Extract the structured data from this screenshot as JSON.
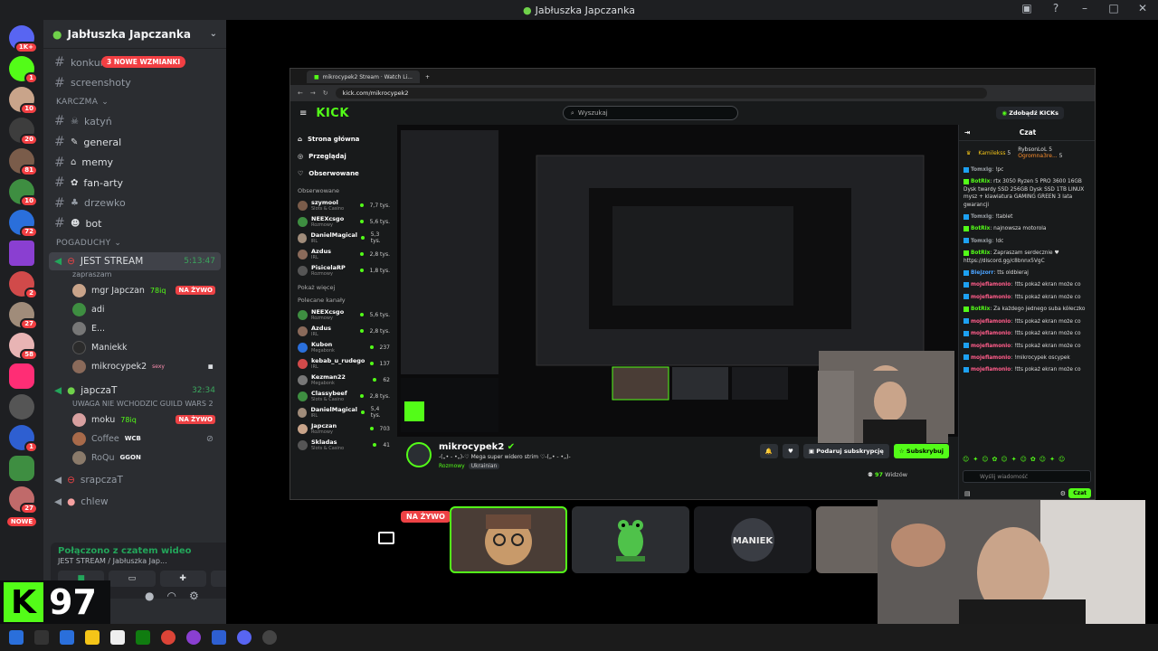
{
  "window": {
    "title": "Jabłuszka Japczanka"
  },
  "rail": {
    "top_badge": "1K+",
    "badges": [
      "1",
      "10",
      "20",
      "81",
      "10",
      "72",
      "2",
      "27",
      "58",
      "1",
      "1",
      "27"
    ],
    "new_label": "NOWE"
  },
  "guild": {
    "name": "Jabłuszka Japczanka",
    "mentions_pill": "3 NOWE WZMIANKI",
    "top_channels": [
      "konkurs-info",
      "screenshoty"
    ],
    "category_karczma": "KARCZMA",
    "channels": [
      "katyń",
      "general",
      "memy",
      "fan-arty",
      "drzewko",
      "bot"
    ],
    "category_pogaduchy": "POGADUCHY",
    "voice1": {
      "name": "JEST STREAM",
      "time": "5:13:47",
      "subtitle": "zapraszam"
    },
    "members1": [
      {
        "name": "mgr Japczan",
        "tag": "78iq",
        "live": "NA ŻYWO"
      },
      {
        "name": "adi"
      },
      {
        "name": "E..."
      },
      {
        "name": "Maniekk"
      },
      {
        "name": "mikrocypek2",
        "tag": "sexy"
      }
    ],
    "voice2": {
      "name": "japczaT",
      "time": "32:34",
      "subtitle": "UWAGA NIE WCHODZIC GUILD WARS 2"
    },
    "members2": [
      {
        "name": "moku",
        "tag": "78iq",
        "live": "NA ŻYWO"
      },
      {
        "name": "Coffee",
        "tag": "WCB"
      },
      {
        "name": "RoQu",
        "tag": "GGON"
      }
    ],
    "more_voice": [
      "srapczaT",
      "chlew"
    ]
  },
  "voice_panel": {
    "status": "Połączono z czatem wideo",
    "location": "JEST STREAM / Jabłuszka Jap..."
  },
  "overlay": {
    "viewers": "97"
  },
  "browser": {
    "tab_title": "mikrocypek2 Stream · Watch Li...",
    "url": "kick.com/mikrocypek2"
  },
  "kick": {
    "brand": "KICK",
    "search_placeholder": "Wyszukaj",
    "get_kicks": "Zdobądź KICKs",
    "nav": [
      "Strona główna",
      "Przeglądaj",
      "Obserwowane"
    ],
    "followed_header": "Obserwowane",
    "followed": [
      {
        "name": "szymool",
        "sub": "Slots & Casino",
        "count": "7,7 tys."
      },
      {
        "name": "NEEXcsgo",
        "sub": "Rozmowy",
        "count": "5,6 tys."
      },
      {
        "name": "DanielMagical",
        "sub": "IRL",
        "count": "5,3 tys."
      },
      {
        "name": "Azdus",
        "sub": "IRL",
        "count": "2,8 tys."
      },
      {
        "name": "PisicelaRP",
        "sub": "Rozmowy",
        "count": "1,8 tys."
      }
    ],
    "show_more": "Pokaż więcej",
    "recommended_header": "Polecane kanały",
    "recommended": [
      {
        "name": "NEEXcsgo",
        "sub": "Rozmowy",
        "count": "5,6 tys."
      },
      {
        "name": "Azdus",
        "sub": "IRL",
        "count": "2,8 tys."
      },
      {
        "name": "Kubon",
        "sub": "Megabonk",
        "count": "237"
      },
      {
        "name": "kebab_u_rudego",
        "sub": "IRL",
        "count": "137"
      },
      {
        "name": "Kezman22",
        "sub": "Megabonk",
        "count": "62"
      },
      {
        "name": "Classybeef",
        "sub": "Slots & Casino",
        "count": "2,8 tys."
      },
      {
        "name": "DanielMagical",
        "sub": "IRL",
        "count": "5,4 tys."
      },
      {
        "name": "Japczan",
        "sub": "Rozmowy",
        "count": "703"
      },
      {
        "name": "Skladas",
        "sub": "Slots & Casino",
        "count": "41"
      }
    ],
    "streamer": "mikrocypek2",
    "stream_title": "-(„• - •„)-♡ Mega super widero strim ♡-(„• - •„)-",
    "category": "Rozmowy",
    "tag": "Ukrainian",
    "gift_sub": "Podaruj subskrypcję",
    "subscribe": "Subskrybuj",
    "viewer_count": "97",
    "viewers_label": "Widzów",
    "chat_title": "Czat",
    "leaderboard": [
      {
        "name": "Kamilekss",
        "val": "5"
      },
      {
        "name": "RybsonLoL",
        "val": "5"
      },
      {
        "name": "Ogromna3re...",
        "val": "5"
      }
    ],
    "messages": [
      {
        "user": "TomxIg",
        "text": "!pc",
        "cls": "g"
      },
      {
        "user": "BotRix",
        "text": "rtx 3050 Ryzen 5 PRO 3600 16GB Dysk twardy SSD 256GB Dysk SSD 1TB LINUX mysz + klawiatura GAMING GREEN 3 lata gwarancji",
        "cls": ""
      },
      {
        "user": "TomxIg",
        "text": "!tablet",
        "cls": "g"
      },
      {
        "user": "BotRix",
        "text": "najnowsza motorola",
        "cls": ""
      },
      {
        "user": "TomxIg",
        "text": "!dc",
        "cls": "g"
      },
      {
        "user": "BotRix",
        "text": "Zapraszam serdecznie ♥ https://discord.gg/c8bnnx5VgC",
        "cls": ""
      },
      {
        "user": "Biejzorr",
        "text": "tts oldbieraj",
        "cls": "b"
      },
      {
        "user": "mojeflamonio",
        "text": "!tts pokaż ekran może co",
        "cls": "p"
      },
      {
        "user": "mojeflamonio",
        "text": "!tts pokaż ekran może co",
        "cls": "p"
      },
      {
        "user": "BotRix",
        "text": "Za każdego jednego suba kółeczko",
        "cls": ""
      },
      {
        "user": "mojeflamonio",
        "text": "!tts pokaż ekran może co",
        "cls": "p"
      },
      {
        "user": "mojeflamonio",
        "text": "!tts pokaż ekran może co",
        "cls": "p"
      },
      {
        "user": "mojeflamonio",
        "text": "!tts pokaż ekran może co",
        "cls": "p"
      },
      {
        "user": "mojeflamonio",
        "text": "!mikrocypek oscypek",
        "cls": "p"
      },
      {
        "user": "mojeflamonio",
        "text": "!tts pokaż ekran może co",
        "cls": "p"
      }
    ],
    "chat_placeholder": "Wyślij wiadomość",
    "chat_button": "Czat"
  },
  "stage": {
    "live_badge": "NA ŻYWO",
    "tile_label_maniek": "MANIEK"
  },
  "colors": {
    "kick_green": "#53fc18",
    "live_red": "#ed4245",
    "discord_bg": "#2b2d31"
  }
}
